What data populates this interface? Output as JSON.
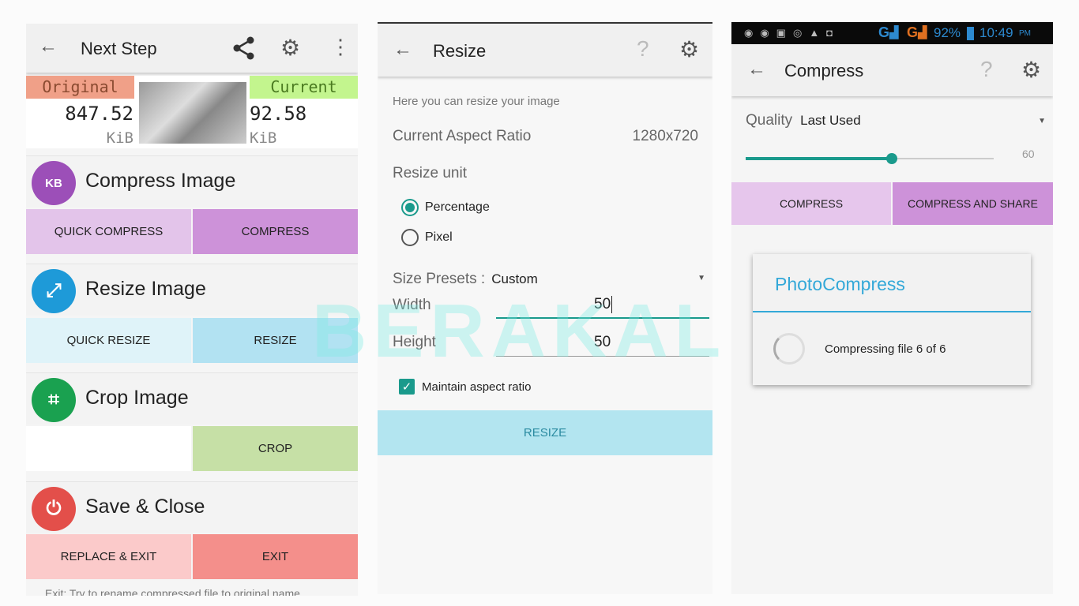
{
  "watermark": "BERAKAL",
  "panel1": {
    "title": "Next Step",
    "icons": [
      "back-arrow-icon",
      "share-icon",
      "gear-icon",
      "more-vert-icon"
    ],
    "original_label": "Original",
    "original_value": "847.52",
    "original_unit": "KiB",
    "current_label": "Current",
    "current_value": "92.58",
    "current_unit": "KiB",
    "sections": [
      {
        "title": "Compress Image",
        "icon": "KB",
        "color": "#9c4fb8",
        "buttons": [
          {
            "label": "Quick Compress",
            "color": "#e3c4ea"
          },
          {
            "label": "Compress",
            "color": "#cd92d9"
          }
        ]
      },
      {
        "title": "Resize Image",
        "icon": "⤢",
        "color": "#1e9ad8",
        "buttons": [
          {
            "label": "Quick Resize",
            "color": "#dff3f9"
          },
          {
            "label": "Resize",
            "color": "#b2e2f2"
          }
        ]
      },
      {
        "title": "Crop Image",
        "icon": "⌗",
        "color": "#1aa150",
        "buttons": [
          {
            "label": "Crop",
            "color": "#c6e0a6"
          }
        ]
      },
      {
        "title": "Save & Close",
        "icon": "⏻",
        "color": "#e34f4a",
        "buttons": [
          {
            "label": "Replace & Exit",
            "color": "#fbcaca"
          },
          {
            "label": "Exit",
            "color": "#f48f8b"
          }
        ]
      }
    ],
    "footer": "Exit: Try to rename compressed file to original name"
  },
  "panel2": {
    "title": "Resize",
    "intro": "Here you can resize your image",
    "aspect_label": "Current Aspect Ratio",
    "aspect_value": "1280x720",
    "unit_label": "Resize unit",
    "units": [
      {
        "label": "Percentage",
        "selected": true
      },
      {
        "label": "Pixel",
        "selected": false
      }
    ],
    "presets_label": "Size Presets :",
    "presets_value": "Custom",
    "width_label": "Width",
    "width_value": "50",
    "height_label": "Height",
    "height_value": "50",
    "maintain_label": "Maintain aspect ratio",
    "maintain_checked": true,
    "resize_button": "Resize",
    "accent": "#1a9a8c"
  },
  "panel3": {
    "status": {
      "battery": "92%",
      "time": "10:49",
      "ampm": "PM",
      "network1": "G",
      "network2": "G"
    },
    "title": "Compress",
    "quality_label": "Quality",
    "quality_value": "Last Used",
    "slider_value": "60",
    "slider_fraction": 0.59,
    "compress_button": "Compress",
    "compress_share_button": "Compress and Share",
    "dialog_title": "PhotoCompress",
    "dialog_message": "Compressing file 6 of 6"
  }
}
